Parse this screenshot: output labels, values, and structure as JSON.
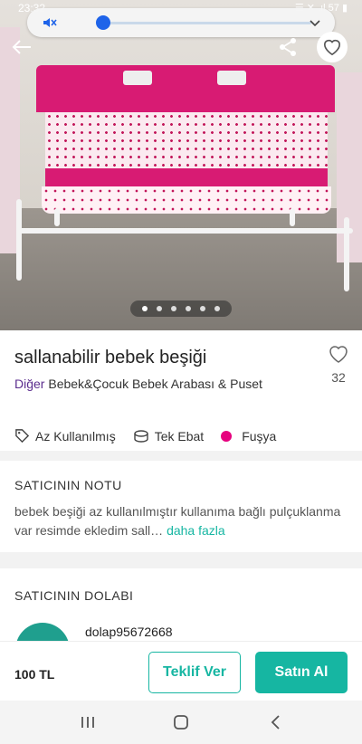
{
  "status_bar": {
    "time": "23:32",
    "right": "☰ ✕ .ıl 57 ▮"
  },
  "listing": {
    "title": "sallanabilir bebek beşiği",
    "like_count": "32",
    "brand": "Diğer",
    "category": "Bebek&Çocuk Bebek Arabası & Puset",
    "image_count": 6,
    "active_image": 1,
    "attributes": {
      "condition": "Az Kullanılmış",
      "size": "Tek Ebat",
      "color_name": "Fuşya",
      "color_hex": "#e6007e"
    }
  },
  "seller_note": {
    "title": "SATICININ NOTU",
    "text": "bebek beşiği az kullanılmıştır kullanıma bağlı pulçuklanma var resimde ekledim sall…",
    "more": "daha fazla"
  },
  "closet": {
    "title": "SATICININ DOLABI",
    "seller": "dolap95672668"
  },
  "footer": {
    "price": "100 TL",
    "offer_label": "Teklif Ver",
    "buy_label": "Satın Al"
  },
  "colors": {
    "accent": "#16b6a2",
    "brand_purple": "#5b2d8e"
  },
  "icons": [
    "mute-icon",
    "chevron-down-icon",
    "back-arrow-icon",
    "share-icon",
    "heart-icon",
    "tag-icon",
    "size-icon",
    "recents-icon",
    "home-icon",
    "nav-back-icon"
  ]
}
